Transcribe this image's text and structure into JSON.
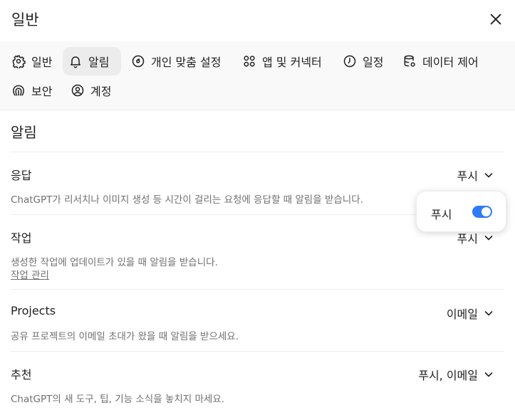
{
  "header": {
    "title": "일반",
    "close_icon": "close-icon"
  },
  "tabs": [
    {
      "label": "일반",
      "icon": "gear-icon"
    },
    {
      "label": "알림",
      "icon": "bell-icon",
      "active": true
    },
    {
      "label": "개인 맞춤 설정",
      "icon": "personalization-icon"
    },
    {
      "label": "앱 및 커넥터",
      "icon": "apps-icon"
    },
    {
      "label": "일정",
      "icon": "clock-icon"
    },
    {
      "label": "데이터 제어",
      "icon": "database-gear-icon"
    },
    {
      "label": "보안",
      "icon": "security-icon"
    },
    {
      "label": "계정",
      "icon": "account-icon"
    }
  ],
  "section": {
    "title": "알림"
  },
  "rows": [
    {
      "title": "응답",
      "desc": "ChatGPT가 리서치나 이미지 생성 등 시간이 걸리는 요청에 응답할 때 알림을 받습니다.",
      "value": "푸시"
    },
    {
      "title": "작업",
      "desc": "생성한 작업에 업데이트가 있을 때 알림을 받습니다.",
      "link": "작업 관리",
      "value": "푸시"
    },
    {
      "title": "Projects",
      "desc": "공유 프로젝트의 이메일 초대가 왔을 때 알림을 받으세요.",
      "value": "이메일"
    },
    {
      "title": "추천",
      "desc": "ChatGPT의 새 도구, 팁, 기능 소식을 놓치지 마세요.",
      "value": "푸시, 이메일"
    }
  ],
  "popover": {
    "label": "푸시",
    "toggle_on": true
  },
  "colors": {
    "accent": "#2f7bf5",
    "tab_active_bg": "#ececec",
    "tabs_bg": "#f9f9f9",
    "muted_text": "#707070"
  }
}
